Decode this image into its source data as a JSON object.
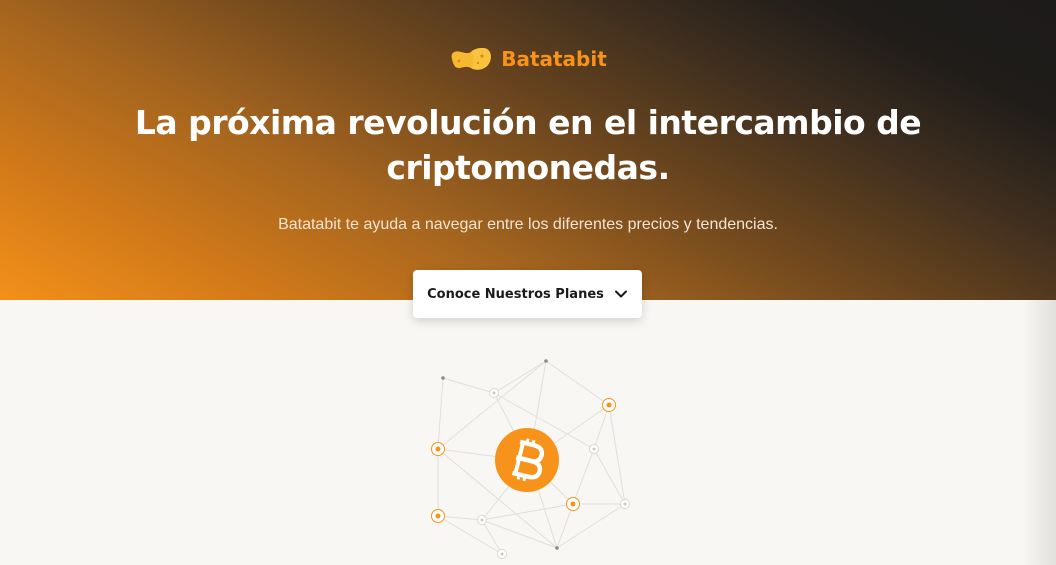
{
  "brand": {
    "name": "Batatabit",
    "logo_icon": "potato-icon",
    "color": "#f7931a"
  },
  "hero": {
    "title_line1": "La próxima revolución en el intercambio de",
    "title_line2": "criptomonedas.",
    "subtitle": "Batatabit te ayuda a navegar entre los diferentes precios y tendencias.",
    "gradient_colors": [
      "#1d1b1a",
      "#f39019"
    ]
  },
  "cta": {
    "label": "Conoce Nuestros Planes",
    "icon": "chevron-down-icon"
  },
  "illustration": {
    "icon": "bitcoin-icon",
    "accent": "#f7931a"
  }
}
